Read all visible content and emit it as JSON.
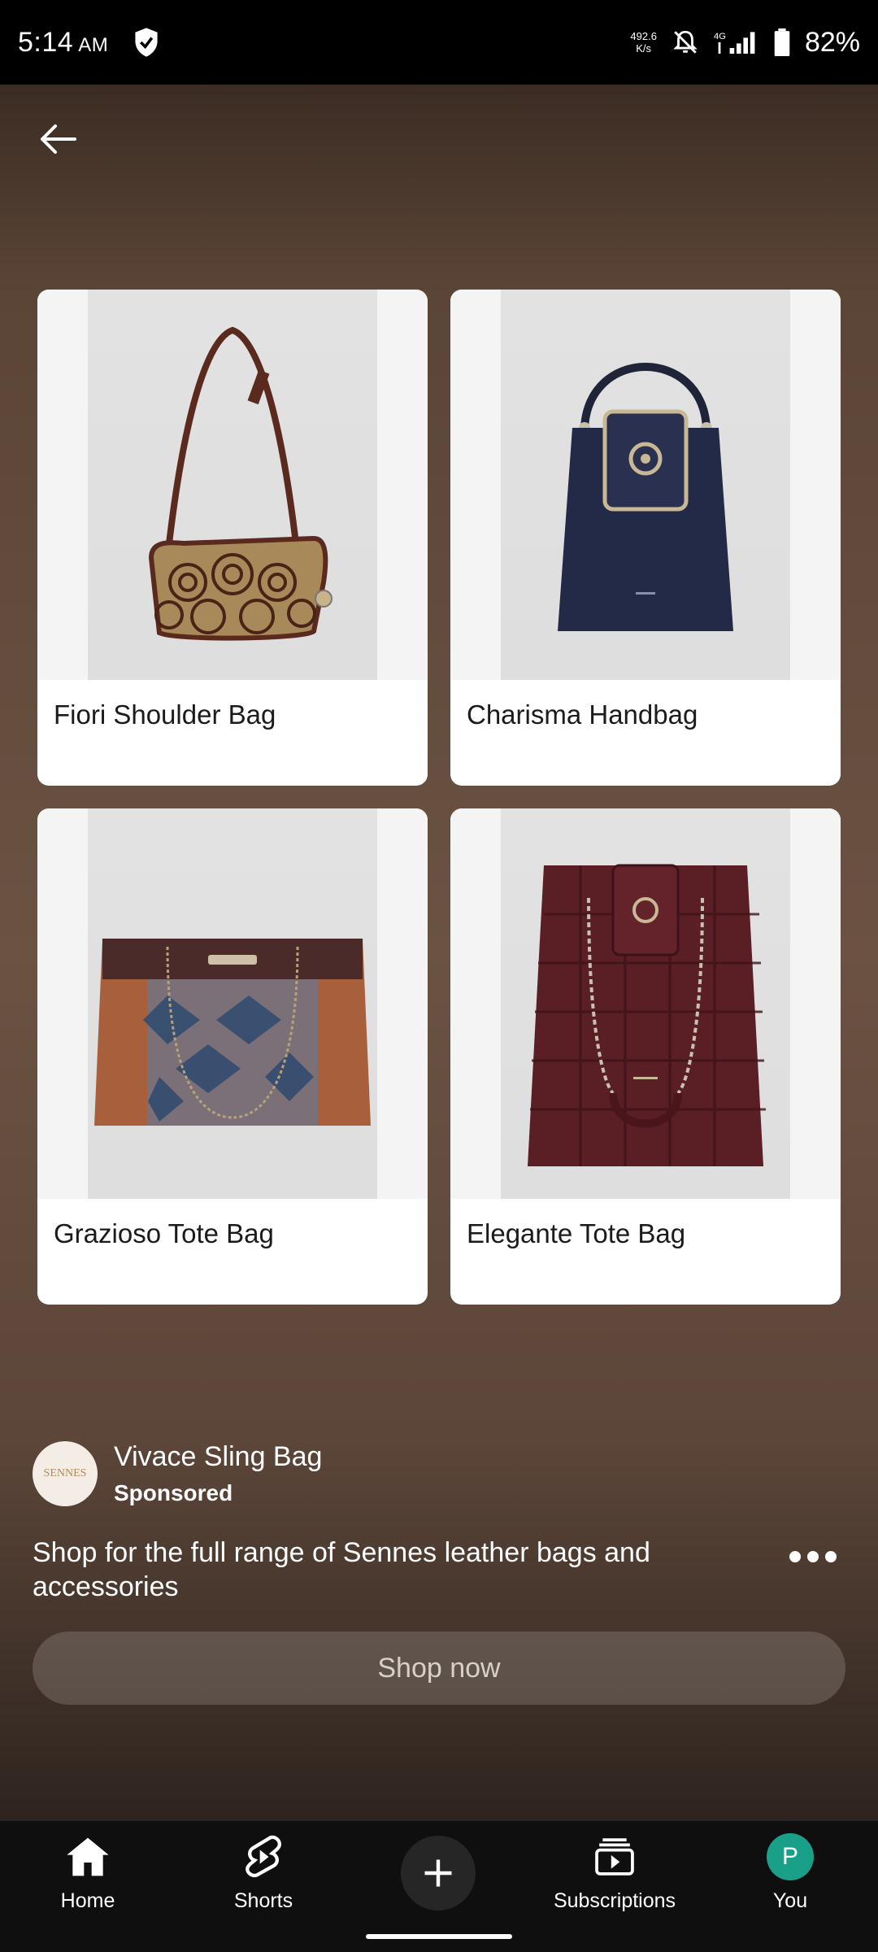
{
  "status_bar": {
    "time": "5:14",
    "ampm": "AM",
    "net_speed_value": "492.6",
    "net_speed_unit": "K/s",
    "network": "4G",
    "battery": "82%"
  },
  "products": [
    {
      "name": "Fiori Shoulder Bag"
    },
    {
      "name": "Charisma Handbag"
    },
    {
      "name": "Grazioso Tote Bag"
    },
    {
      "name": "Elegante Tote Bag"
    }
  ],
  "ad": {
    "title": "Vivace Sling Bag",
    "sponsored": "Sponsored",
    "description": "Shop for the full range of Sennes leather bags and accessories",
    "cta": "Shop now",
    "logo_text": "SENNES"
  },
  "nav": {
    "home": "Home",
    "shorts": "Shorts",
    "subscriptions": "Subscriptions",
    "you": "You",
    "avatar_letter": "P"
  },
  "colors": {
    "accent_avatar": "#1aa089",
    "background": "#6b5243"
  }
}
